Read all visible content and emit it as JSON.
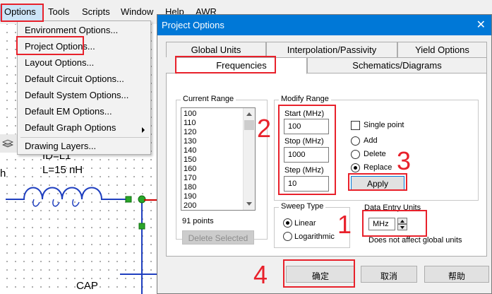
{
  "menubar": {
    "items": [
      "Options",
      "Tools",
      "Scripts",
      "Window",
      "Help",
      "AWR"
    ]
  },
  "options_menu": {
    "items": [
      "Environment Options...",
      "Project Options...",
      "Layout Options...",
      "Default Circuit Options...",
      "Default System Options...",
      "Default EM Options...",
      "Default Graph Options",
      "Drawing Layers..."
    ]
  },
  "schematic": {
    "id_text": "ID=L1",
    "l_text": "L=15 nH",
    "cap_text": "CAP",
    "left_fragment": "h"
  },
  "dialog": {
    "title": "Project Options",
    "close_glyph": "✕",
    "tabs_back": [
      "Global Units",
      "Interpolation/Passivity",
      "Yield Options"
    ],
    "tabs_front": [
      "Frequencies",
      "Schematics/Diagrams"
    ],
    "current_range": {
      "title": "Current Range",
      "values": [
        "100",
        "110",
        "120",
        "130",
        "140",
        "150",
        "160",
        "170",
        "180",
        "190",
        "200"
      ],
      "points": "91 points",
      "delete_button": "Delete Selected"
    },
    "modify_range": {
      "title": "Modify Range",
      "start_label": "Start (MHz)",
      "start_value": "100",
      "stop_label": "Stop (MHz)",
      "stop_value": "1000",
      "step_label": "Step (MHz)",
      "step_value": "10",
      "single_point": "Single point",
      "add": "Add",
      "delete": "Delete",
      "replace": "Replace",
      "apply": "Apply"
    },
    "sweep_type": {
      "title": "Sweep Type",
      "linear": "Linear",
      "logarithmic": "Logarithmic"
    },
    "data_entry": {
      "title": "Data Entry Units",
      "unit": "MHz",
      "note": "Does not affect global units"
    },
    "buttons": {
      "ok": "确定",
      "cancel": "取消",
      "help": "帮助"
    }
  },
  "annotations": [
    "2",
    "3",
    "1",
    "4"
  ],
  "colors": {
    "annotation_red": "#e8212b",
    "titlebar_blue": "#0078d7",
    "wire_blue": "#1f3fbf",
    "node_green": "#2aa52a"
  }
}
